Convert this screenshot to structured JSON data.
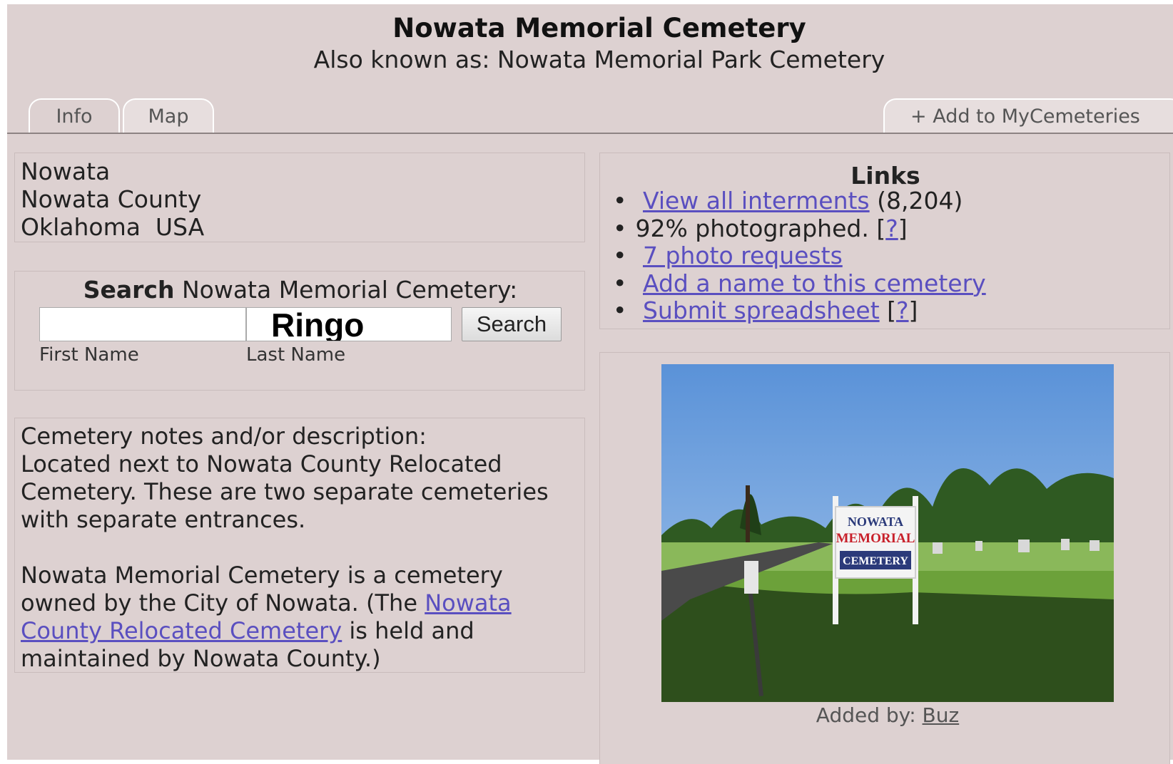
{
  "header": {
    "title": "Nowata Memorial Cemetery",
    "subtitle": "Also known as: Nowata Memorial Park Cemetery"
  },
  "tabs": {
    "info": "Info",
    "map": "Map",
    "add": "+ Add to MyCemeteries"
  },
  "address": {
    "city": "Nowata",
    "county": "Nowata County",
    "state_country": "Oklahoma  USA"
  },
  "search": {
    "heading_bold": "Search",
    "heading_rest": "Nowata Memorial Cemetery:",
    "first_name_value": "",
    "last_name_value": "Ringo",
    "button": "Search",
    "first_label": "First Name",
    "last_label": "Last Name"
  },
  "notes": {
    "heading": "Cemetery notes and/or description:",
    "p1": "Located next to Nowata County Relocated Cemetery. These are two separate cemeteries with separate entrances.",
    "p2_before": "Nowata Memorial Cemetery is a cemetery owned by the City of Nowata. (The ",
    "p2_link": "Nowata County Relocated Cemetery",
    "p2_after": " is held and maintained by Nowata County.)"
  },
  "links": {
    "title": "Links",
    "view_all": "View all interments",
    "view_all_count": "(8,204)",
    "photographed": "92% photographed. [",
    "help": "?",
    "close_bracket": "]",
    "photo_requests": "7 photo requests",
    "add_name": "Add a name to this cemetery",
    "submit": "Submit spreadsheet",
    "open_bracket": "["
  },
  "photo": {
    "sign_line1": "NOWATA",
    "sign_line2": "MEMORIAL",
    "sign_line3": "CEMETERY",
    "caption_label": "Added by:",
    "caption_user": "Buz"
  }
}
